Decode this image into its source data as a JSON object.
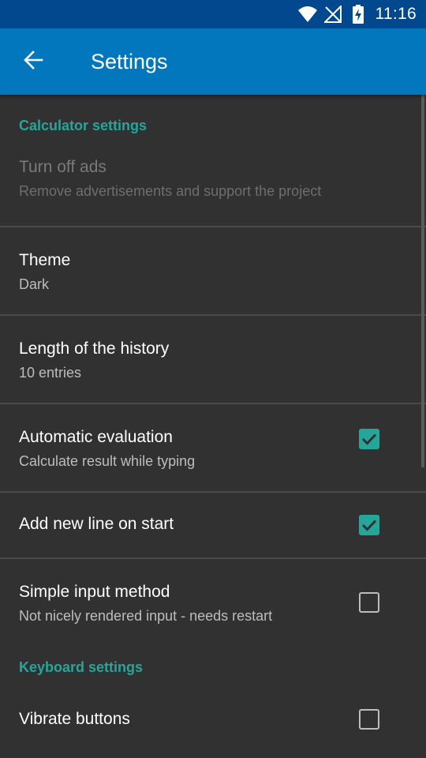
{
  "status_bar": {
    "time": "11:16",
    "icons": [
      "wifi-icon",
      "no-signal-icon",
      "battery-charging-icon"
    ]
  },
  "app_bar": {
    "title": "Settings",
    "back_icon": "arrow-back-icon"
  },
  "sections": {
    "calculator": {
      "header": "Calculator settings",
      "turn_off_ads": {
        "title": "Turn off ads",
        "summary": "Remove advertisements and support the project",
        "enabled": false
      },
      "theme": {
        "title": "Theme",
        "summary": "Dark"
      },
      "history_length": {
        "title": "Length of the history",
        "summary": "10 entries"
      },
      "automatic_evaluation": {
        "title": "Automatic evaluation",
        "summary": "Calculate result while typing",
        "checked": true
      },
      "add_new_line": {
        "title": "Add new line on start",
        "checked": true
      },
      "simple_input": {
        "title": "Simple input method",
        "summary": "Not nicely rendered input - needs restart",
        "checked": false
      }
    },
    "keyboard": {
      "header": "Keyboard settings",
      "vibrate_buttons": {
        "title": "Vibrate buttons",
        "checked": false
      }
    }
  },
  "colors": {
    "status_bar": "#02488f",
    "app_bar": "#0277bd",
    "background": "#313131",
    "accent": "#26a69a",
    "divider": "#4a4a4a"
  }
}
